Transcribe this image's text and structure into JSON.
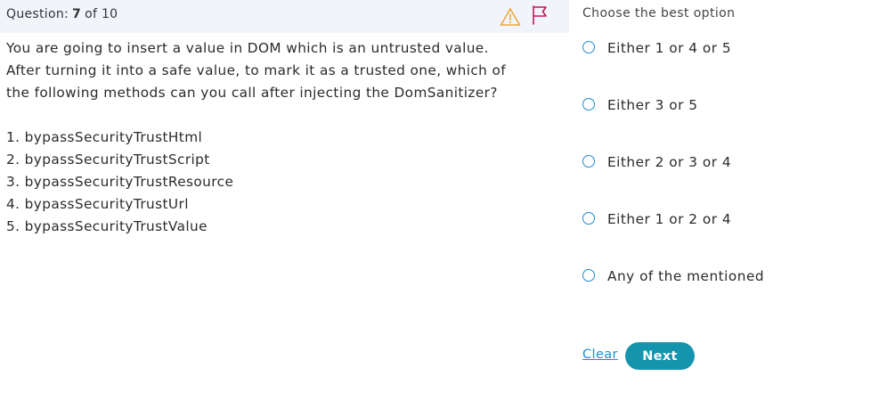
{
  "question_bar": {
    "label": "Question:",
    "current": "7",
    "of_text": "of 10",
    "warning_icon": "warning-triangle-icon",
    "flag_icon": "flag-icon",
    "warning_color": "#f0a73a",
    "flag_color": "#c2185b"
  },
  "question": {
    "lines": [
      "You are going to insert a value in DOM which is an untrusted value.",
      "After turning it into a safe value, to mark it as a trusted one, which of",
      "the following methods can you call after injecting the DomSanitizer?"
    ],
    "methods": [
      "1. bypassSecurityTrustHtml",
      "2. bypassSecurityTrustScript",
      "3. bypassSecurityTrustResource",
      "4. bypassSecurityTrustUrl",
      "5. bypassSecurityTrustValue"
    ]
  },
  "answers": {
    "heading": "Choose the best option",
    "options": [
      "Either 1 or 4 or 5",
      "Either 3 or 5",
      "Either 2 or 3 or 4",
      "Either 1 or 2 or 4",
      "Any of the mentioned"
    ],
    "radio_color": "#1f8ccd"
  },
  "actions": {
    "clear_label": "Clear",
    "next_label": "Next",
    "next_color": "#1594ae"
  }
}
